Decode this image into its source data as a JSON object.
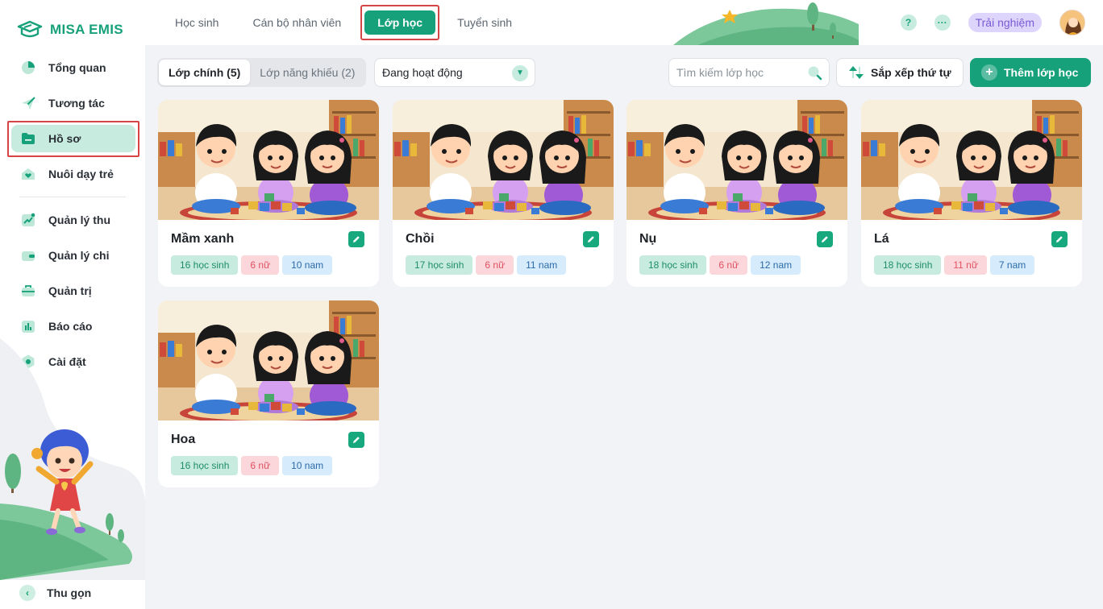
{
  "app": {
    "brand": "MISA EMIS"
  },
  "sidebar": {
    "items": [
      {
        "label": "Tổng quan",
        "icon": "pie-chart-icon"
      },
      {
        "label": "Tương tác",
        "icon": "paper-plane-icon"
      },
      {
        "label": "Hồ sơ",
        "icon": "folder-icon",
        "active": true
      },
      {
        "label": "Nuôi dạy trẻ",
        "icon": "heart-house-icon"
      },
      {
        "label": "Quản lý thu",
        "icon": "trend-chart-icon"
      },
      {
        "label": "Quản lý chi",
        "icon": "wallet-icon"
      },
      {
        "label": "Quản trị",
        "icon": "briefcase-icon"
      },
      {
        "label": "Báo cáo",
        "icon": "bar-chart-icon"
      },
      {
        "label": "Cài đặt",
        "icon": "gear-icon"
      }
    ],
    "collapse_label": "Thu gọn"
  },
  "topbar": {
    "tabs": [
      {
        "label": "Học sinh"
      },
      {
        "label": "Cán bộ nhân viên"
      },
      {
        "label": "Lớp học",
        "active": true
      },
      {
        "label": "Tuyển sinh"
      }
    ],
    "help_label": "?",
    "more_label": "···",
    "trial_label": "Trải nghiệm"
  },
  "toolbar": {
    "segments": [
      {
        "label": "Lớp chính (5)",
        "active": true
      },
      {
        "label": "Lớp năng khiếu (2)"
      }
    ],
    "status_select": "Đang hoạt động",
    "search_placeholder": "Tìm kiếm lớp học",
    "sort_label": "Sắp xếp thứ tự",
    "add_label": "Thêm lớp học"
  },
  "classes": [
    {
      "name": "Mầm xanh",
      "students": "16 học sinh",
      "female": "6 nữ",
      "male": "10 nam"
    },
    {
      "name": "Chồi",
      "students": "17 học sinh",
      "female": "6 nữ",
      "male": "11 nam"
    },
    {
      "name": "Nụ",
      "students": "18 học sinh",
      "female": "6 nữ",
      "male": "12 nam"
    },
    {
      "name": "Lá",
      "students": "18 học sinh",
      "female": "11 nữ",
      "male": "7 nam"
    },
    {
      "name": "Hoa",
      "students": "16 học sinh",
      "female": "6 nữ",
      "male": "10 nam"
    }
  ],
  "colors": {
    "brand": "#16a17a",
    "active_bg": "#c7ecdf",
    "highlight": "#d64545"
  }
}
